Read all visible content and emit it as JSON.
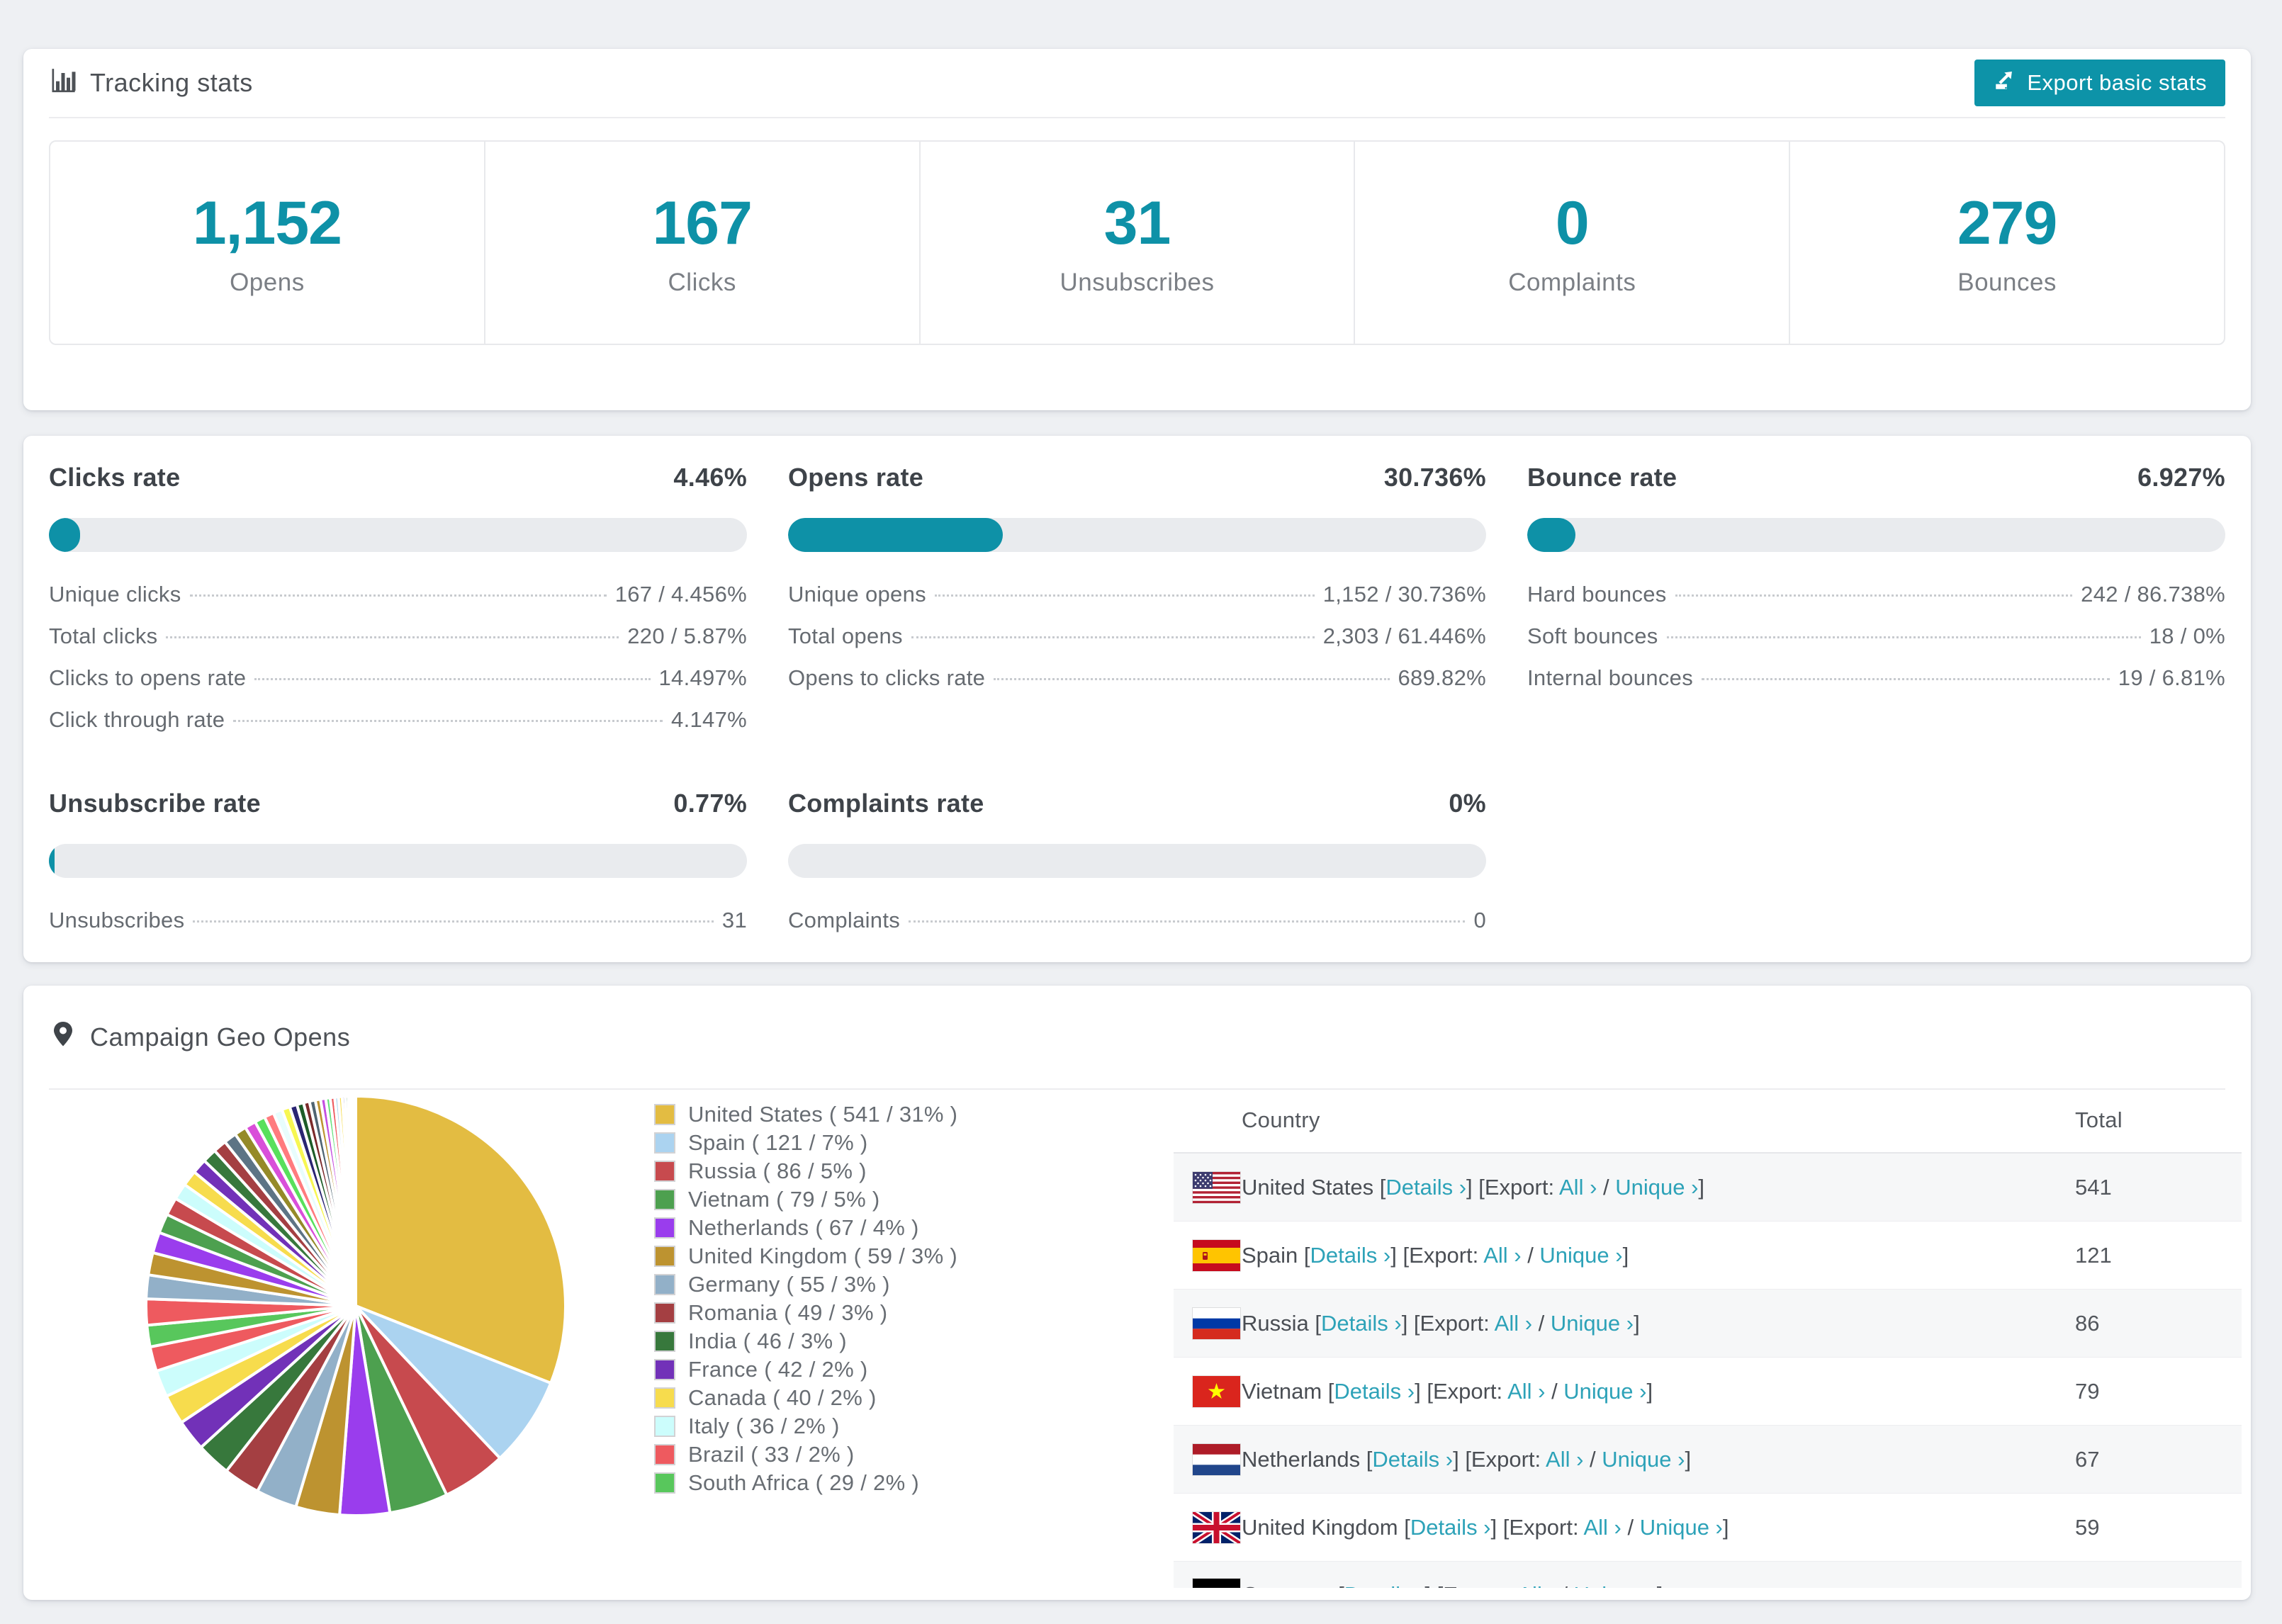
{
  "brand": {
    "teal": "#0e91a7",
    "link_teal": "#2da2b8",
    "bar_track": "#e9ebee"
  },
  "icons": {
    "tracking_header": "bar-chart-icon",
    "export_button": "export-icon",
    "geo_header": "map-pin-icon",
    "link_chevron": "›"
  },
  "tracking_panel": {
    "title": "Tracking stats",
    "export_label": "Export basic stats",
    "stats": [
      {
        "value": "1,152",
        "label": "Opens"
      },
      {
        "value": "167",
        "label": "Clicks"
      },
      {
        "value": "31",
        "label": "Unsubscribes"
      },
      {
        "value": "0",
        "label": "Complaints"
      },
      {
        "value": "279",
        "label": "Bounces"
      }
    ]
  },
  "rates_panel": {
    "cards": [
      {
        "title": "Clicks rate",
        "value": "4.46%",
        "rows": [
          {
            "label": "Unique clicks",
            "value": "167 / 4.456%"
          },
          {
            "label": "Total clicks",
            "value": "220 / 5.87%"
          },
          {
            "label": "Clicks to opens rate",
            "value": "14.497%"
          },
          {
            "label": "Click through rate",
            "value": "4.147%"
          }
        ]
      },
      {
        "title": "Opens rate",
        "value": "30.736%",
        "rows": [
          {
            "label": "Unique opens",
            "value": "1,152 / 30.736%"
          },
          {
            "label": "Total opens",
            "value": "2,303 / 61.446%"
          },
          {
            "label": "Opens to clicks rate",
            "value": "689.82%"
          }
        ]
      },
      {
        "title": "Bounce rate",
        "value": "6.927%",
        "rows": [
          {
            "label": "Hard bounces",
            "value": "242 / 86.738%"
          },
          {
            "label": "Soft bounces",
            "value": "18 / 0%"
          },
          {
            "label": "Internal bounces",
            "value": "19 / 6.81%"
          }
        ]
      },
      {
        "title": "Unsubscribe rate",
        "value": "0.77%",
        "rows": [
          {
            "label": "Unsubscribes",
            "value": "31"
          }
        ]
      },
      {
        "title": "Complaints rate",
        "value": "0%",
        "rows": [
          {
            "label": "Complaints",
            "value": "0"
          }
        ]
      }
    ]
  },
  "geo_panel": {
    "title": "Campaign Geo Opens",
    "links": {
      "open": " [",
      "details": "Details ›",
      "mid": "] [Export: ",
      "all": "All ›",
      "slash": " / ",
      "unique": "Unique ›",
      "close": "]"
    },
    "table": {
      "headers": {
        "country": "Country",
        "total": "Total"
      },
      "rows": [
        {
          "country": "United States",
          "total": "541"
        },
        {
          "country": "Spain",
          "total": "121"
        },
        {
          "country": "Russia",
          "total": "86"
        },
        {
          "country": "Vietnam",
          "total": "79"
        },
        {
          "country": "Netherlands",
          "total": "67"
        },
        {
          "country": "United Kingdom",
          "total": "59"
        },
        {
          "country": "Germany",
          "total": ""
        }
      ]
    }
  },
  "chart_data": {
    "type": "pie",
    "title": "Campaign Geo Opens",
    "legend_position": "right",
    "start_angle_deg": -90,
    "direction": "clockwise",
    "slices": [
      {
        "label": "United States",
        "value": 541,
        "pct": 31,
        "color": "#e3bc42",
        "legend_label": "United States ( 541 / 31% )"
      },
      {
        "label": "Spain",
        "value": 121,
        "pct": 7,
        "color": "#abd3f0",
        "legend_label": "Spain ( 121 / 7% )"
      },
      {
        "label": "Russia",
        "value": 86,
        "pct": 5,
        "color": "#c74a4e",
        "legend_label": "Russia ( 86 / 5% )"
      },
      {
        "label": "Vietnam",
        "value": 79,
        "pct": 5,
        "color": "#4da04f",
        "legend_label": "Vietnam ( 79 / 5% )"
      },
      {
        "label": "Netherlands",
        "value": 67,
        "pct": 4,
        "color": "#9a3ded",
        "legend_label": "Netherlands ( 67 / 4% )"
      },
      {
        "label": "United Kingdom",
        "value": 59,
        "pct": 3,
        "color": "#bd9330",
        "legend_label": "United Kingdom ( 59 / 3% )"
      },
      {
        "label": "Germany",
        "value": 55,
        "pct": 3,
        "color": "#92b0c8",
        "legend_label": "Germany ( 55 / 3% )"
      },
      {
        "label": "Romania",
        "value": 49,
        "pct": 3,
        "color": "#a43f42",
        "legend_label": "Romania ( 49 / 3% )"
      },
      {
        "label": "India",
        "value": 46,
        "pct": 3,
        "color": "#37783c",
        "legend_label": "India ( 46 / 3% )"
      },
      {
        "label": "France",
        "value": 42,
        "pct": 2,
        "color": "#7231b8",
        "legend_label": "France ( 42 / 2% )"
      },
      {
        "label": "Canada",
        "value": 40,
        "pct": 2,
        "color": "#f7dc4d",
        "legend_label": "Canada ( 40 / 2% )"
      },
      {
        "label": "Italy",
        "value": 36,
        "pct": 2,
        "color": "#ccfdfc",
        "legend_label": "Italy ( 36 / 2% )"
      },
      {
        "label": "Brazil",
        "value": 33,
        "pct": 2,
        "color": "#ee5a5f",
        "legend_label": "Brazil ( 33 / 2% )"
      },
      {
        "label": "South Africa",
        "value": 29,
        "pct": 2,
        "color": "#58c75c",
        "legend_label": "South Africa ( 29 / 2% )"
      }
    ],
    "others": {
      "note": "remaining unlabeled thin slices, estimated from arc",
      "values": [
        35,
        32,
        30,
        28,
        26,
        24,
        22,
        21,
        20,
        19,
        18,
        17,
        16,
        15,
        14,
        13,
        12,
        11,
        10,
        9,
        8,
        8,
        7,
        7,
        6,
        6,
        5,
        5,
        4,
        4,
        3,
        3,
        2,
        1,
        1
      ],
      "colors": [
        "#ee5a5f",
        "#92b0c8",
        "#bd9330",
        "#9a3ded",
        "#4da04f",
        "#c74a4e",
        "#ccfdfc",
        "#f7dc4d",
        "#7231b8",
        "#37783c",
        "#a43f42",
        "#5d7485",
        "#958a28",
        "#d94fd9",
        "#58e05c",
        "#ff7b7e",
        "#e8fdfd",
        "#f7f752",
        "#2a2572",
        "#1d5c28",
        "#7a2a2a",
        "#4f6472",
        "#bd9330",
        "#c44fe0",
        "#66e07c",
        "#ee5a5f",
        "#abd3f0",
        "#f7dc4d",
        "#372d8f",
        "#2a7d3a",
        "#8f3333",
        "#92b0c8",
        "#a8992e",
        "#e06ee0",
        "#4da04f"
      ]
    }
  }
}
